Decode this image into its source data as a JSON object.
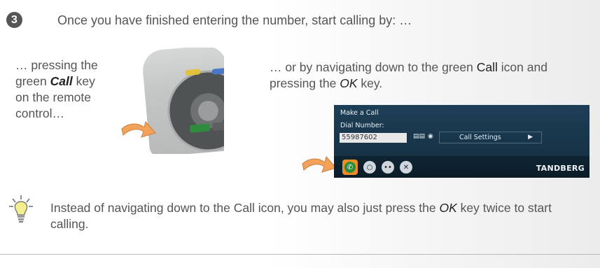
{
  "step": {
    "number": "3",
    "intro": "Once you have finished entering the number, start calling by: …"
  },
  "left_caption": {
    "part1": "… pressing the green ",
    "call": "Call",
    "part2": " key on the remote control…"
  },
  "right_caption": {
    "part1": "… or by navigating down to the green ",
    "call": "Call",
    "part2": " icon and pressing the ",
    "ok": "OK",
    "part3": " key."
  },
  "call_ui": {
    "title": "Make a Call",
    "dial_label": "Dial Number:",
    "dial_value": "55987602",
    "settings_label": "Call Settings",
    "brand": "TANDBERG",
    "icons": [
      "phonebook-icon",
      "lock-icon",
      "call-icon",
      "video-icon",
      "directory-icon",
      "close-icon"
    ]
  },
  "tip": {
    "part1": "Instead of navigating down to the Call icon, you may also just press the ",
    "ok": "OK",
    "part2": " key twice to start calling."
  },
  "colors": {
    "panel_bg": "#173448",
    "call_green": "#2c8c3b",
    "highlight_orange": "#f08c22",
    "arrow_orange": "#f2a259"
  }
}
